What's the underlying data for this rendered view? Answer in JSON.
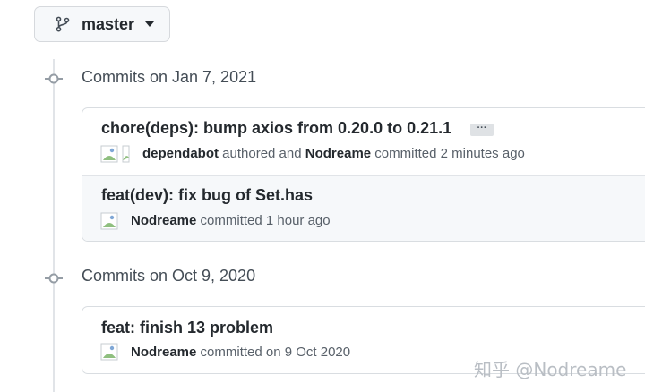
{
  "branch": {
    "name": "master",
    "icon": "git-branch-icon"
  },
  "groups": [
    {
      "heading": "Commits on Jan 7, 2021",
      "commits": [
        {
          "title": "chore(deps): bump axios from 0.20.0 to 0.21.1",
          "ellipsis": "···",
          "author": "dependabot",
          "authored_text": "authored and",
          "committer": "Nodreame",
          "committed_text": "committed 2 minutes ago"
        },
        {
          "title": "feat(dev): fix bug of Set.has",
          "author": "Nodreame",
          "committed_text": "committed 1 hour ago"
        }
      ]
    },
    {
      "heading": "Commits on Oct 9, 2020",
      "commits": [
        {
          "title": "feat: finish 13 problem",
          "author": "Nodreame",
          "committed_text": "committed on 9 Oct 2020"
        }
      ]
    }
  ],
  "watermark": "知乎 @Nodreame",
  "colors": {
    "border": "#d9dde1",
    "alt_row": "#f6f8fa",
    "timeline": "#e1e4e8"
  }
}
